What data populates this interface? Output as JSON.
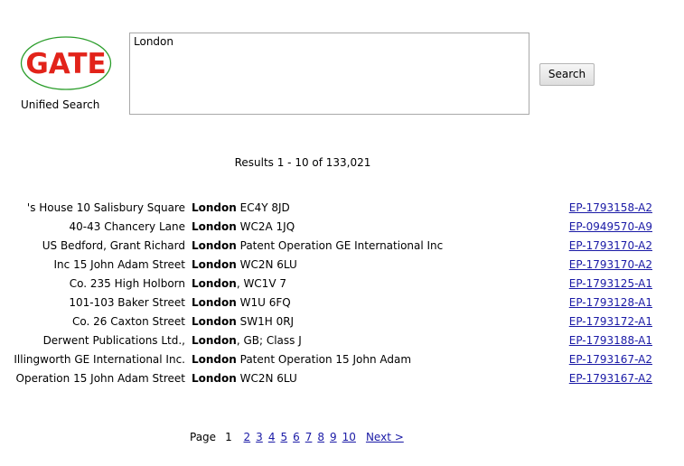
{
  "header": {
    "logo_text": "GATE",
    "logo_caption": "Unified Search",
    "query_value": "London",
    "search_label": "Search"
  },
  "colors": {
    "logo_red": "#e2231a",
    "logo_green": "#2a9d2a",
    "link_blue": "#1a1aa6"
  },
  "results": {
    "summary": "Results 1 - 10 of 133,021",
    "rows": [
      {
        "left": "'s House 10 Salisbury Square",
        "kw": "London",
        "right": " EC4Y 8JD",
        "doc": "EP-1793158-A2"
      },
      {
        "left": "40-43 Chancery Lane",
        "kw": "London",
        "right": " WC2A 1JQ",
        "doc": "EP-0949570-A9"
      },
      {
        "left": "US Bedford, Grant Richard",
        "kw": "London",
        "right": " Patent Operation GE International Inc",
        "doc": "EP-1793170-A2"
      },
      {
        "left": "Inc 15 John Adam Street",
        "kw": "London",
        "right": " WC2N 6LU",
        "doc": "EP-1793170-A2"
      },
      {
        "left": "Co. 235 High Holborn",
        "kw": "London",
        "right": ", WC1V 7",
        "doc": "EP-1793125-A1"
      },
      {
        "left": "101-103 Baker Street",
        "kw": "London",
        "right": " W1U 6FQ",
        "doc": "EP-1793128-A1"
      },
      {
        "left": "Co. 26 Caxton Street",
        "kw": "London",
        "right": " SW1H 0RJ",
        "doc": "EP-1793172-A1"
      },
      {
        "left": "Derwent Publications Ltd.,",
        "kw": "London",
        "right": ", GB; Class J",
        "doc": "EP-1793188-A1"
      },
      {
        "left": "Illingworth GE International Inc.",
        "kw": "London",
        "right": " Patent Operation 15 John Adam",
        "doc": "EP-1793167-A2"
      },
      {
        "left": "Operation 15 John Adam Street",
        "kw": "London",
        "right": " WC2N 6LU",
        "doc": "EP-1793167-A2"
      }
    ]
  },
  "pager": {
    "label": "Page",
    "current": "1",
    "pages": [
      "2",
      "3",
      "4",
      "5",
      "6",
      "7",
      "8",
      "9",
      "10"
    ],
    "next": "Next >"
  }
}
